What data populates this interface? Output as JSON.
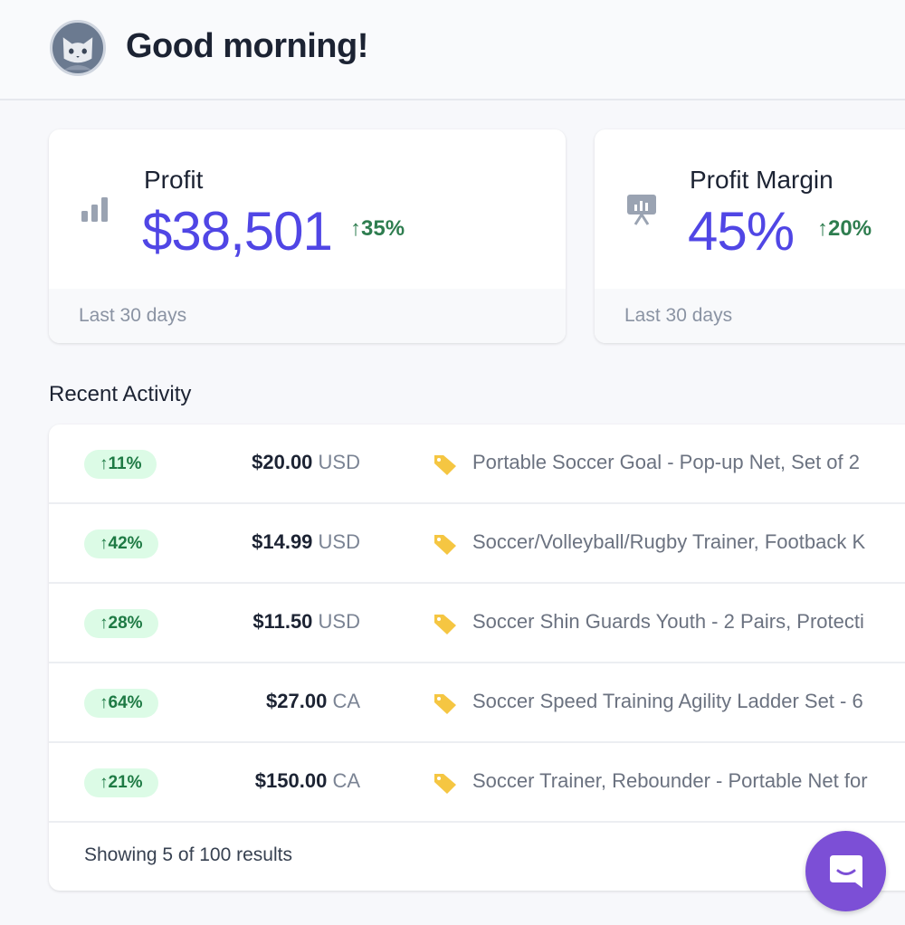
{
  "header": {
    "greeting": "Good morning!",
    "avatar_icon": "cat-avatar-icon"
  },
  "stats": [
    {
      "label": "Profit",
      "value": "$38,501",
      "change": "↑35%",
      "period": "Last 30 days",
      "icon": "bar-chart-icon"
    },
    {
      "label": "Profit Margin",
      "value": "45%",
      "change": "↑20%",
      "period": "Last 30 days",
      "icon": "presentation-chart-icon"
    }
  ],
  "activity": {
    "title": "Recent Activity",
    "rows": [
      {
        "change": "↑11%",
        "amount": "$20.00",
        "currency": "USD",
        "description": "Portable Soccer Goal - Pop-up Net, Set of 2"
      },
      {
        "change": "↑42%",
        "amount": "$14.99",
        "currency": "USD",
        "description": "Soccer/Volleyball/Rugby Trainer, Footback K"
      },
      {
        "change": "↑28%",
        "amount": "$11.50",
        "currency": "USD",
        "description": "Soccer Shin Guards Youth - 2 Pairs, Protecti"
      },
      {
        "change": "↑64%",
        "amount": "$27.00",
        "currency": "CA",
        "description": "Soccer Speed Training Agility Ladder Set - 6"
      },
      {
        "change": "↑21%",
        "amount": "$150.00",
        "currency": "CA",
        "description": "Soccer Trainer, Rebounder - Portable Net for"
      }
    ],
    "results_text": "Showing 5 of 100 results"
  },
  "colors": {
    "accent": "#5046e5",
    "positive": "#2e7d4f",
    "badge_bg": "#dcfbe6",
    "chat_button": "#7c4fd6"
  }
}
